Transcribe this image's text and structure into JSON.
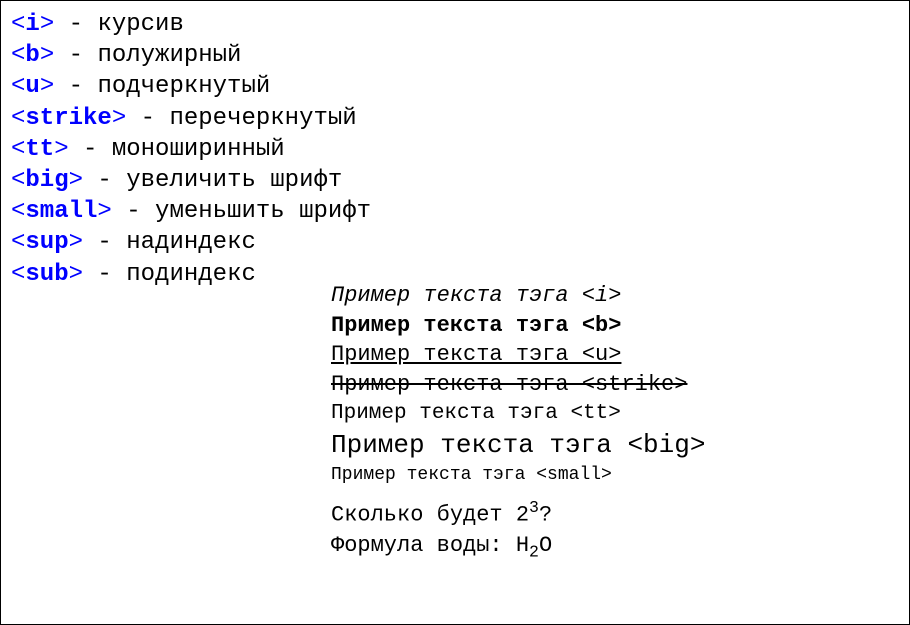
{
  "definitions": [
    {
      "tag": "i",
      "desc": "курсив"
    },
    {
      "tag": "b",
      "desc": "полужирный"
    },
    {
      "tag": "u",
      "desc": "подчеркнутый"
    },
    {
      "tag": "strike",
      "desc": "перечеркнутый"
    },
    {
      "tag": "tt",
      "desc": "моноширинный"
    },
    {
      "tag": "big",
      "desc": "увеличить шрифт"
    },
    {
      "tag": "small",
      "desc": "уменьшить шрифт"
    },
    {
      "tag": "sup",
      "desc": "надиндекс"
    },
    {
      "tag": "sub",
      "desc": "подиндекс"
    }
  ],
  "examples": {
    "i": "Пример текста тэга <i>",
    "b": "Пример текста тэга <b>",
    "u": "Пример текста тэга <u>",
    "strike": "Пример текста тэга <strike>",
    "tt": "Пример текста тэга <tt>",
    "big": "Пример текста тэга <big>",
    "small": "Пример текста тэга <small>",
    "sup_prefix": "Сколько будет 2",
    "sup_exp": "3",
    "sup_suffix": "?",
    "sub_prefix": "Формула воды: H",
    "sub_idx": "2",
    "sub_suffix": "O"
  },
  "glyphs": {
    "lt": "<",
    "gt": ">",
    "dash": " - "
  }
}
